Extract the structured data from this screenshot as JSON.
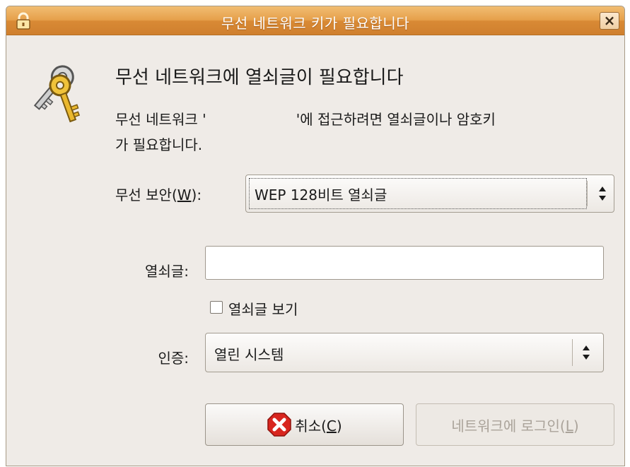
{
  "window": {
    "title": "무선 네트워크 키가 필요합니다",
    "close_glyph": "×"
  },
  "dialog": {
    "heading": "무선 네트워크에 열쇠글이 필요합니다",
    "message_line1": "무선 네트워크 '                    '에 접근하려면 열쇠글이나 암호키",
    "message_line2": "가 필요합니다."
  },
  "security": {
    "label_prefix": "무선 보안(",
    "label_mnemonic": "W",
    "label_suffix": "):",
    "value": "WEP 128비트 열쇠글"
  },
  "key": {
    "label": "열쇠글:",
    "value": ""
  },
  "show_key": {
    "label": "열쇠글 보기",
    "checked": false
  },
  "auth": {
    "label": "인증:",
    "value": "열린 시스템"
  },
  "buttons": {
    "cancel_prefix": "취소(",
    "cancel_mnemonic": "C",
    "cancel_suffix": ")",
    "login_prefix": "네트워크에 로그인(",
    "login_mnemonic": "L",
    "login_suffix": ")"
  },
  "colors": {
    "titlebar": "#e6a04b",
    "dialog_bg": "#efebe7",
    "cancel_icon": "#d8261f"
  },
  "icons": [
    "padlock-icon",
    "close-icon",
    "keys-icon",
    "combo-arrows-icon",
    "cancel-x-icon"
  ]
}
